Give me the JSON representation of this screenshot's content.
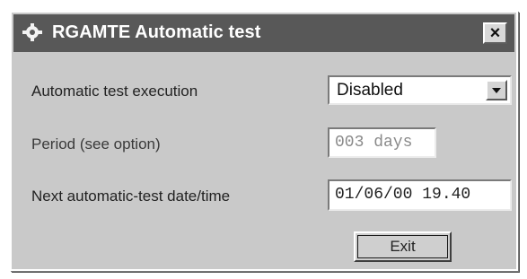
{
  "window": {
    "title": "RGAMTE Automatic test",
    "title_icon": "app-gear-icon",
    "close_icon": "close-icon",
    "close_glyph": "×"
  },
  "form": {
    "execution_label": "Automatic test execution",
    "execution_value": "Disabled",
    "period_label": "Period (see option)",
    "period_value": "003 days",
    "next_label": "Next automatic-test date/time",
    "next_value": "01/06/00 19.40"
  },
  "buttons": {
    "exit_label": "Exit"
  }
}
